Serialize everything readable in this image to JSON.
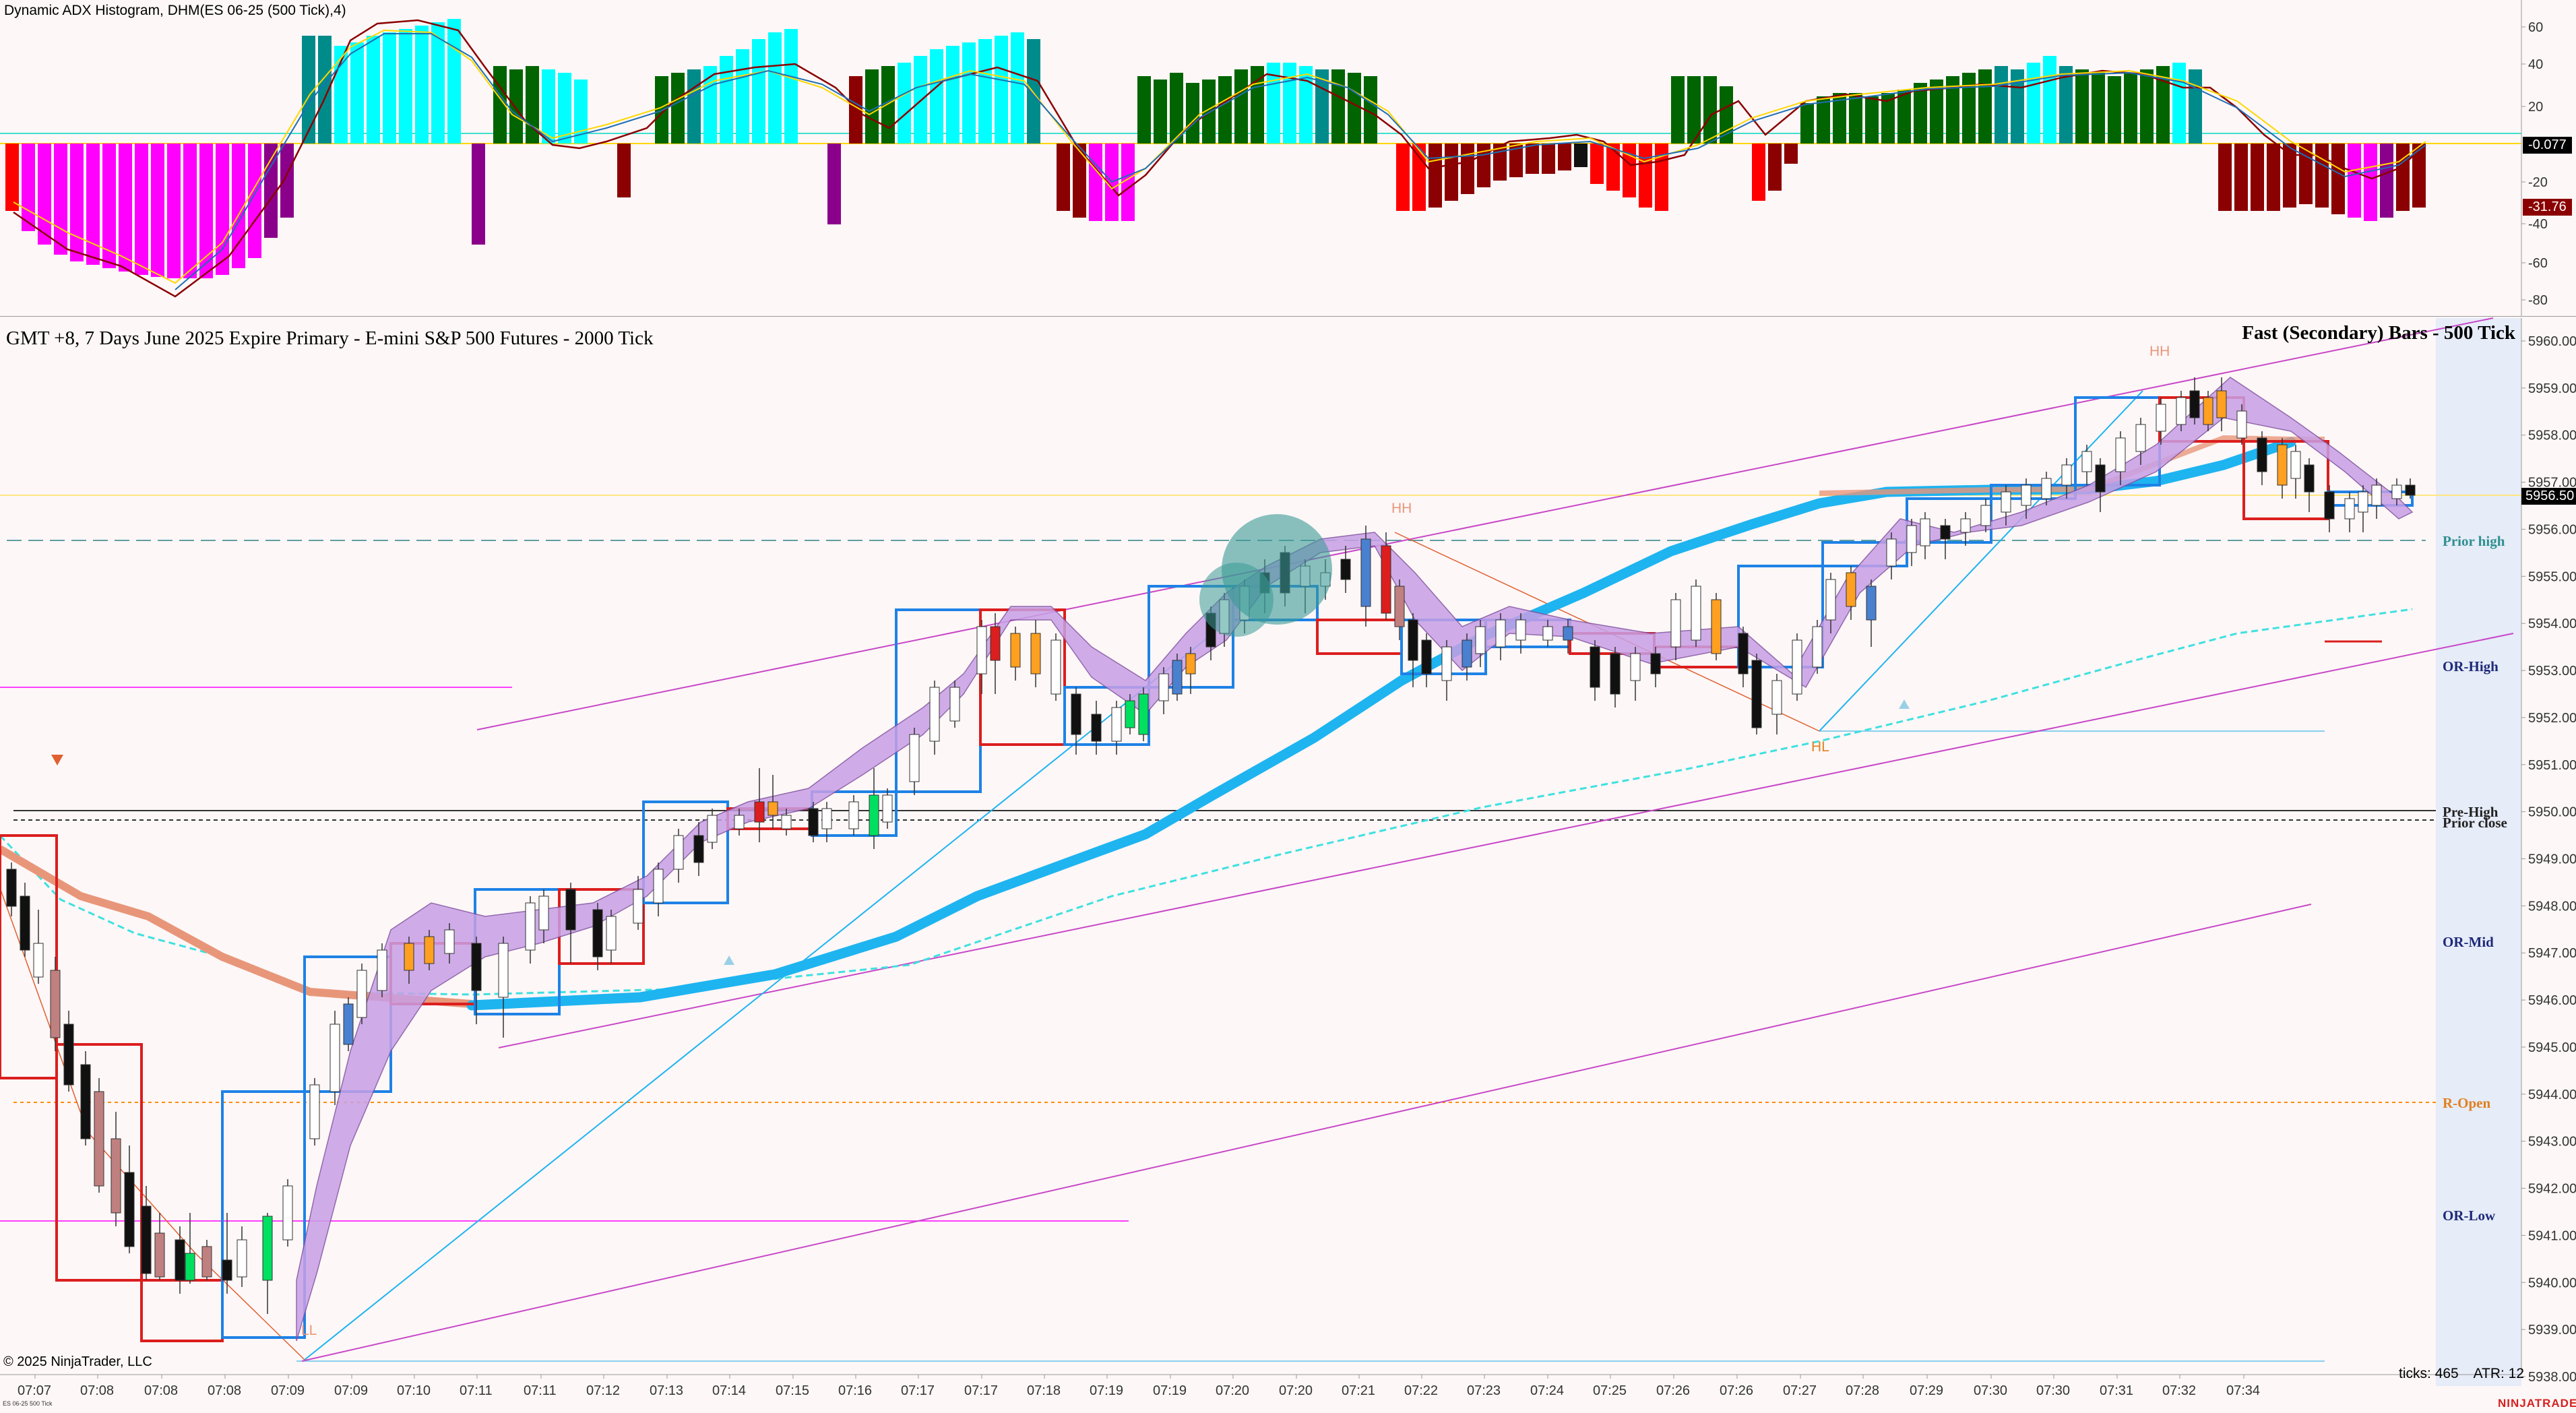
{
  "indicator": {
    "title": "Dynamic ADX Histogram, DHM(ES 06-25 (500 Tick),4)",
    "yticks": [
      "60",
      "40",
      "20",
      "-20",
      "-40",
      "-60",
      "-80"
    ],
    "value_badges": [
      "-0.077",
      "-31.76"
    ]
  },
  "main": {
    "title": "GMT +8, 7 Days June 2025 Expire Primary   - E-mini S&P 500 Futures - 2000 Tick",
    "secondary_title": "Fast (Secondary) Bars - 500 Tick",
    "yticks": [
      "5960.00",
      "5959.00",
      "5958.00",
      "5957.00",
      "5956.00",
      "5955.00",
      "5954.00",
      "5953.00",
      "5952.00",
      "5951.00",
      "5950.00",
      "5949.00",
      "5948.00",
      "5947.00",
      "5946.00",
      "5945.00",
      "5944.00",
      "5943.00",
      "5942.00",
      "5941.00",
      "5940.00",
      "5939.00",
      "5938.00"
    ],
    "last_price": "5956.50",
    "levels": {
      "prior_high": "Prior high",
      "or_high": "OR-High",
      "pre_high": "Pre-High",
      "prior_close": "Prior close",
      "or_mid": "OR-Mid",
      "r_open": "R-Open",
      "or_low": "OR-Low"
    },
    "swing_labels": {
      "hh1": "HH",
      "hh2": "HH",
      "hl": "HL",
      "ll": "LL"
    }
  },
  "xaxis": {
    "times": [
      "07:07",
      "07:08",
      "07:08",
      "07:08",
      "07:09",
      "07:09",
      "07:10",
      "07:11",
      "07:11",
      "07:12",
      "07:13",
      "07:14",
      "07:15",
      "07:16",
      "07:17",
      "07:17",
      "07:18",
      "07:19",
      "07:19",
      "07:20",
      "07:20",
      "07:21",
      "07:22",
      "07:23",
      "07:24",
      "07:25",
      "07:26",
      "07:26",
      "07:27",
      "07:28",
      "07:29",
      "07:30",
      "07:30",
      "07:31",
      "07:32",
      "07:34"
    ]
  },
  "footer": {
    "copyright": "© 2025 NinjaTrader, LLC",
    "ticks": "ticks: 465",
    "atr": "ATR: 12",
    "brand": "NINJATRADER",
    "instrument_small": "ES 06-25 500 Tick"
  },
  "colors": {
    "background": "#fdf7f7",
    "hist_magenta": "#ff00ff",
    "hist_cyan": "#00ffff",
    "hist_teal": "#008b8b",
    "hist_green": "#006400",
    "hist_red": "#ff0000",
    "hist_darkred": "#8b0000",
    "hist_purple": "#8b008b",
    "ema_fast": "#1eb4f0",
    "ema_slow": "#e8967a",
    "channel": "#c846c8",
    "box_blue": "#1e82e6",
    "box_red": "#dc1e1e"
  }
}
